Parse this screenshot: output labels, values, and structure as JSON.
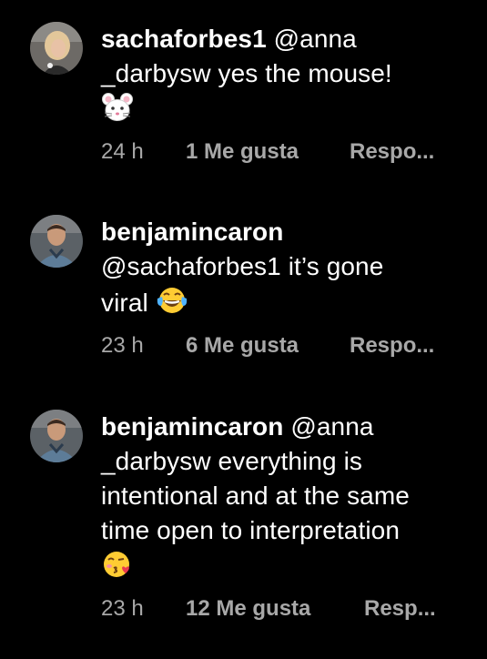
{
  "theme": {
    "background": "#000000",
    "text": "#ffffff",
    "meta_text": "#a8a8a8"
  },
  "comments": [
    {
      "username": "sachaforbes1",
      "text": "@anna _darbysw yes the mouse!",
      "text_line1": "@anna",
      "text_line2": "_darbysw yes the mouse!",
      "emoji": "mouse-face-icon",
      "time": "24 h",
      "likes": "1 Me gusta",
      "reply": "Respo..."
    },
    {
      "username": "benjamincaron",
      "text": "@sachaforbes1 it’s gone viral",
      "text_line1": "@sachaforbes1 it’s gone",
      "text_line2": "viral",
      "emoji": "tears-of-joy-icon",
      "time": "23 h",
      "likes": "6 Me gusta",
      "reply": "Respo..."
    },
    {
      "username": "benjamincaron",
      "text": "@anna _darbysw everything is intentional and at the same time open to interpretation",
      "text_line1": "@anna",
      "text_line2": "_darbysw everything is",
      "text_line3": "intentional and at the same",
      "text_line4": "time open to interpretation",
      "emoji": "face-blowing-kiss-icon",
      "time": "23 h",
      "likes": "12 Me gusta",
      "reply": "Resp..."
    }
  ]
}
